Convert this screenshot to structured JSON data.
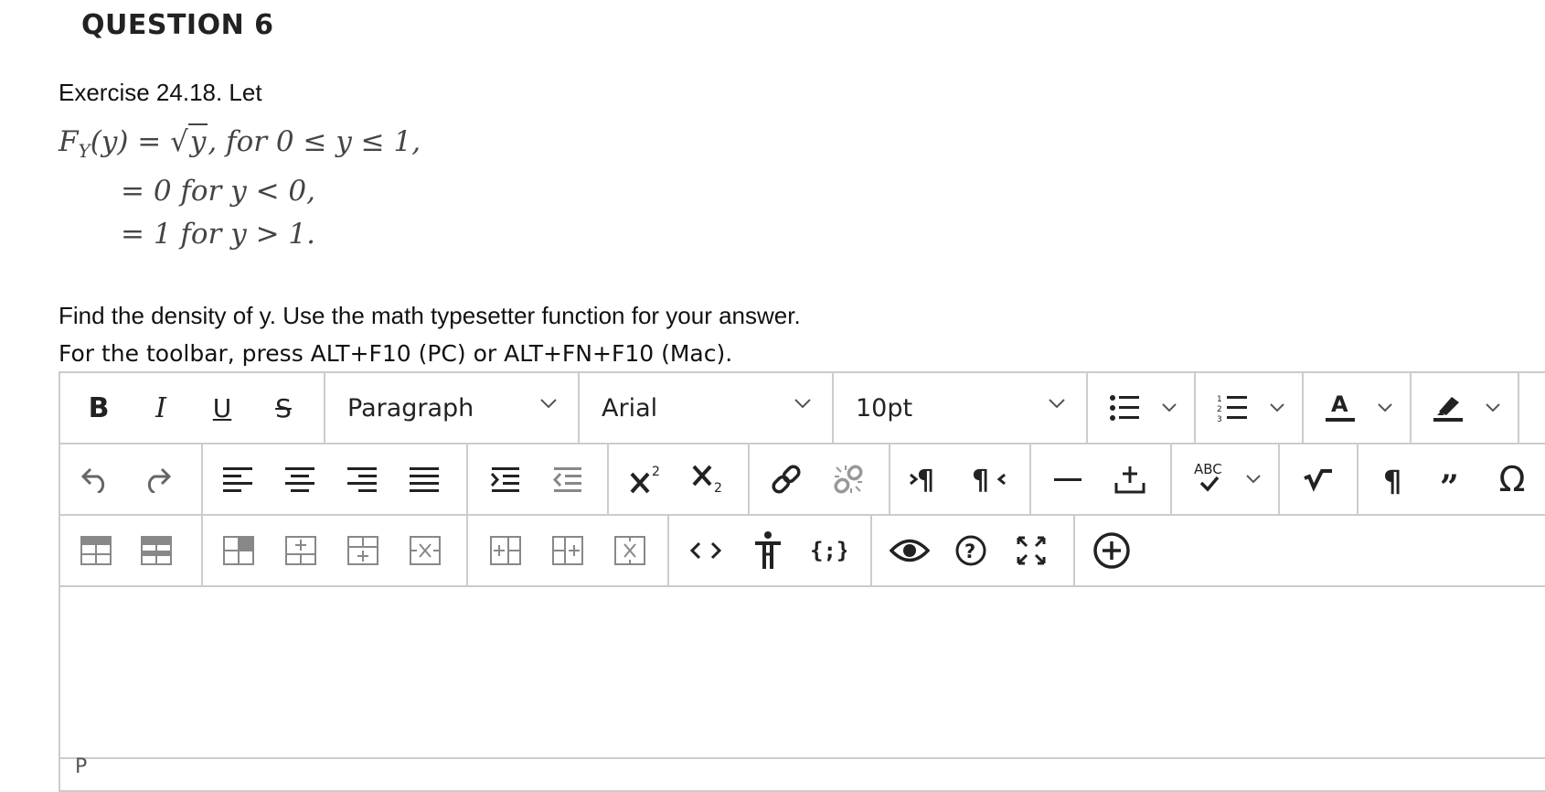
{
  "question": {
    "title": "QUESTION 6",
    "exercise": "Exercise 24.18.  Let",
    "math": {
      "line1_lhs": "F",
      "line1_sub": "Y",
      "line1_arg": "(y) = ",
      "line1_sqrt": "y",
      "line1_rest": ", for 0 ≤ y ≤ 1,",
      "line2": "= 0 for y < 0,",
      "line3": "= 1 for y > 1."
    },
    "prompt": "Find the density of y.  Use the math typesetter function for your answer.",
    "toolbar_hint": "For the toolbar, press ALT+F10 (PC) or ALT+FN+F10 (Mac)."
  },
  "editor": {
    "bold_label": "B",
    "italic_label": "I",
    "underline_label": "U",
    "strike_label": "S",
    "block_format": "Paragraph",
    "font_family": "Arial",
    "font_size": "10pt",
    "spellcheck_label": "ABC",
    "status_path": "P"
  },
  "icons": [
    "bold-icon",
    "italic-icon",
    "underline-icon",
    "strikethrough-icon",
    "bullet-list-icon",
    "numbered-list-icon",
    "text-color-icon",
    "highlight-icon",
    "undo-icon",
    "redo-icon",
    "align-left-icon",
    "align-center-icon",
    "align-right-icon",
    "justify-icon",
    "indent-icon",
    "outdent-icon",
    "superscript-icon",
    "subscript-icon",
    "link-icon",
    "unlink-icon",
    "ltr-icon",
    "rtl-icon",
    "horizontal-rule-icon",
    "insert-anchor-icon",
    "spellcheck-icon",
    "math-icon",
    "show-blocks-icon",
    "blockquote-icon",
    "special-char-icon",
    "table-icon",
    "table-props-icon",
    "cell-icon",
    "row-insert-before-icon",
    "row-insert-after-icon",
    "row-delete-icon",
    "col-insert-before-icon",
    "col-insert-after-icon",
    "col-delete-icon",
    "source-code-icon",
    "accessibility-icon",
    "code-sample-icon",
    "preview-icon",
    "help-icon",
    "fullscreen-icon",
    "add-content-icon"
  ],
  "colors": {
    "border": "#cccccc",
    "icon": "#222222",
    "math_text": "#444444"
  }
}
